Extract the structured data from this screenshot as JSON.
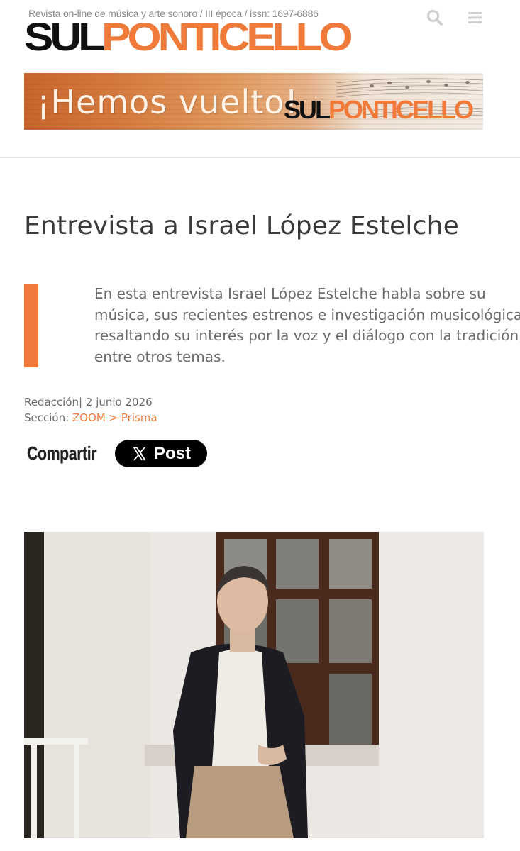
{
  "header": {
    "tagline": "Revista on-line de música y arte sonoro / III época / issn: 1697-6886",
    "logo": {
      "part1": "SUL",
      "part2": "PONTICELLO"
    },
    "icons": [
      "search-icon",
      "menu-icon"
    ]
  },
  "banner": {
    "headline": "¡Hemos vuelto!",
    "logo": {
      "part1": "SUL",
      "part2": "PONTICELLO"
    }
  },
  "article": {
    "title": "Entrevista a Israel López Estelche",
    "lead_lines": [
      "En esta entrevista Israel López Estelche habla sobre su",
      "música, sus recientes estrenos e investigación musicológica,",
      "resaltando su interés por la voz y el diálogo con la tradición,",
      "entre otros temas."
    ],
    "author": "Redacción",
    "separator": "|",
    "date": "2 junio 2026",
    "section_label": "Sección:",
    "section_link": "ZOOM > Prisma"
  },
  "share": {
    "label": "Compartir",
    "x_post_label": "Post"
  },
  "colors": {
    "accent": "#ef7a3a",
    "logo_dark": "#111111",
    "text": "#3a3a3a",
    "muted": "#6b6b6b"
  }
}
